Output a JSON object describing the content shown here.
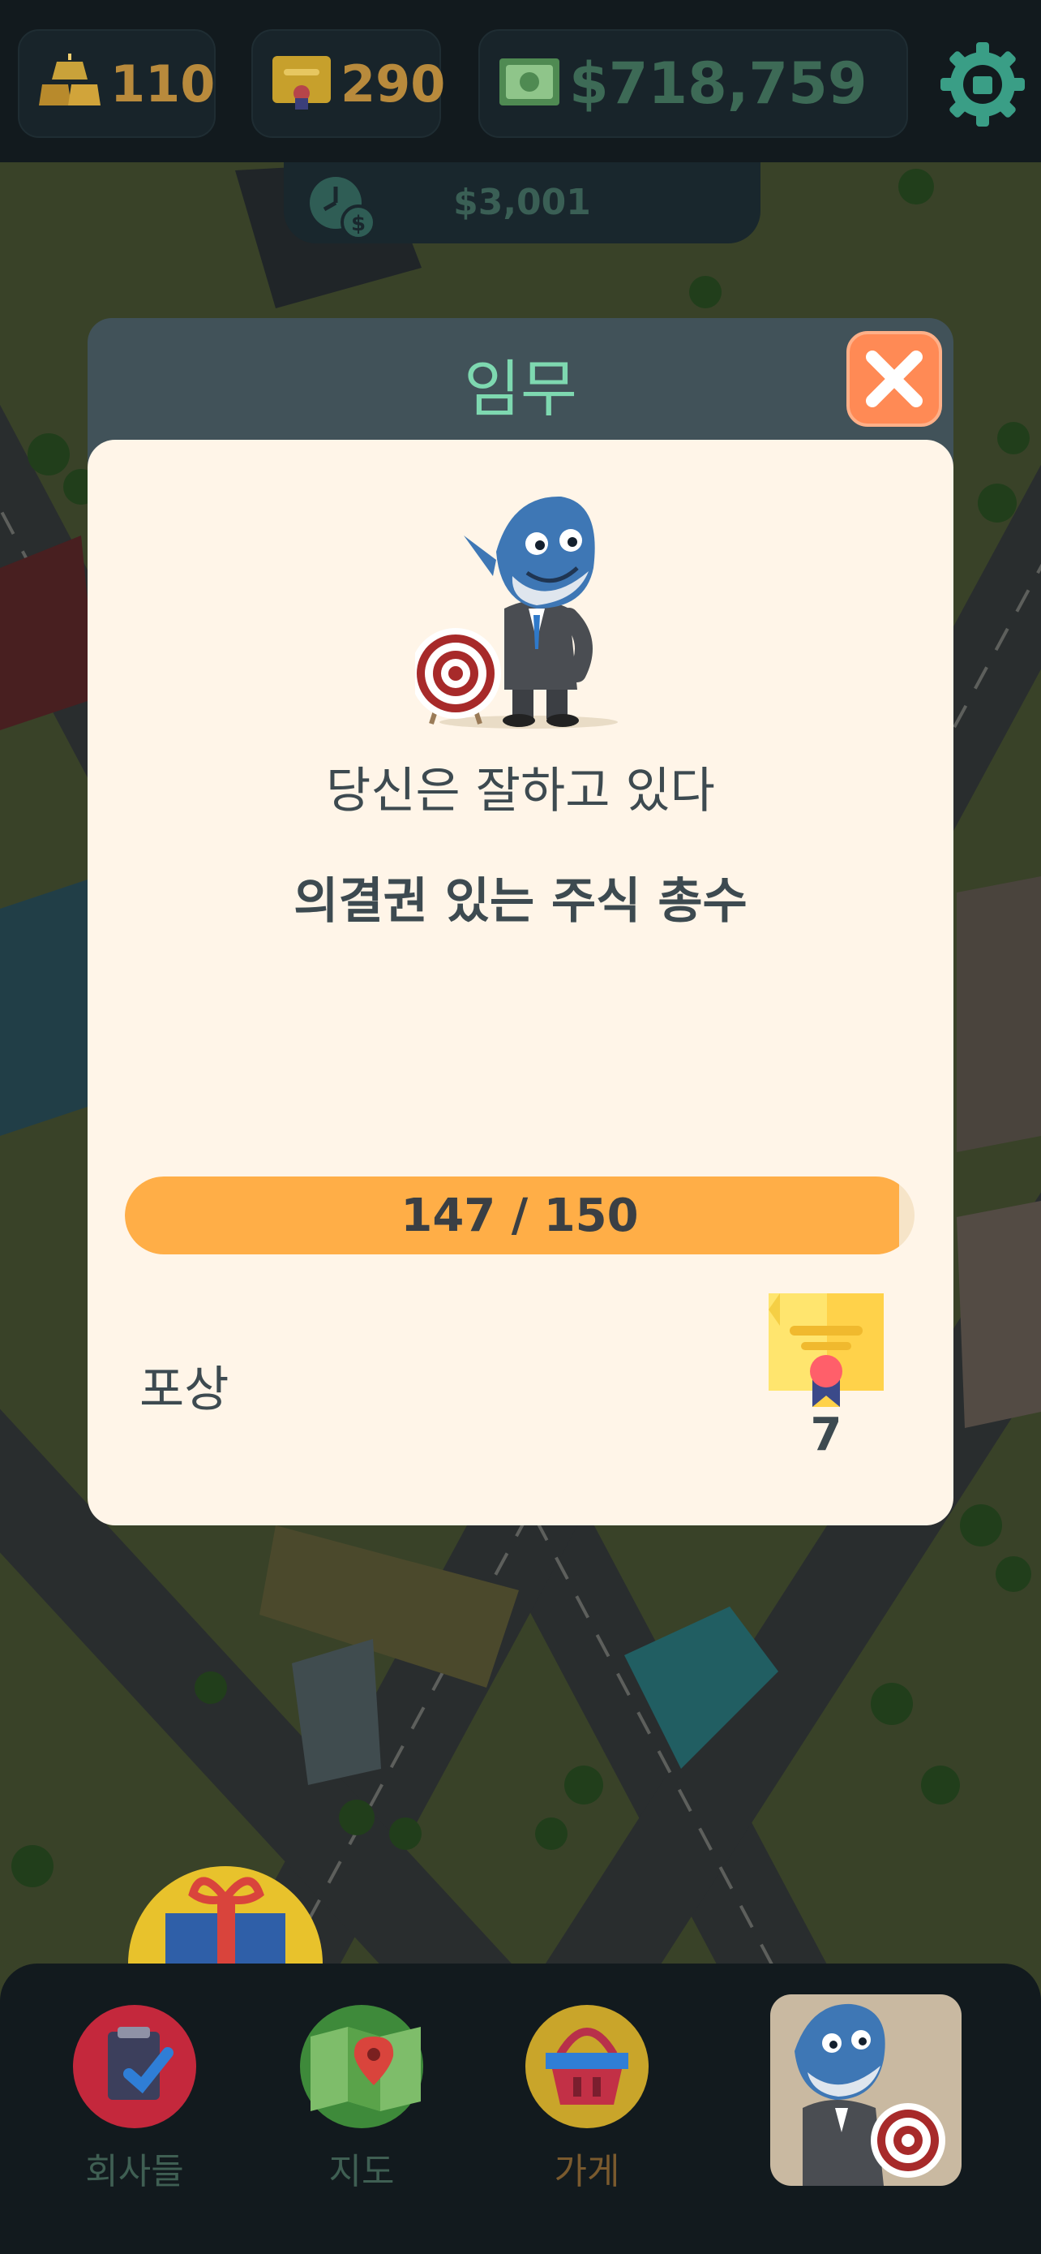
{
  "resources": {
    "gold": "110",
    "certificates": "290",
    "cash": "$718,759"
  },
  "income_rate": "$3,001",
  "dialog": {
    "title": "임무",
    "headline": "당신은 잘하고 있다",
    "mission": "의결권 있는 주식 총수",
    "progress": {
      "current": 147,
      "target": 150,
      "text": "147 / 150"
    },
    "reward_label": "포상",
    "reward_count": "7"
  },
  "nav": {
    "companies": "회사들",
    "map": "지도",
    "shop": "가게"
  },
  "colors": {
    "accent": "#7ed8b0",
    "progress_fill": "#ffae47",
    "close": "#ff8a55"
  }
}
